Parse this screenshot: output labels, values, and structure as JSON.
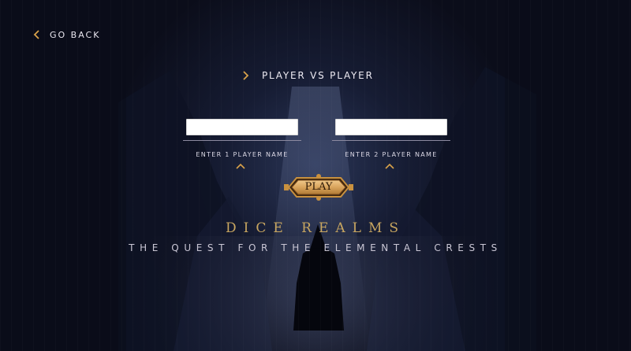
{
  "nav": {
    "back_label": "GO BACK",
    "back_icon": "chevron-left-icon"
  },
  "mode": {
    "title": "PLAYER VS PLAYER",
    "icon": "chevron-right-icon"
  },
  "players": [
    {
      "input_value": "",
      "label": "ENTER 1 PLAYER NAME"
    },
    {
      "input_value": "",
      "label": "ENTER 2 PLAYER NAME"
    }
  ],
  "play_button": {
    "label": "PLAY"
  },
  "game": {
    "title": "DICE REALMS",
    "subtitle": "THE QUEST FOR THE ELEMENTAL CRESTS"
  },
  "colors": {
    "accent": "#d9a24a",
    "title_gold": "#c8a660",
    "background": "#0b0d1a"
  }
}
